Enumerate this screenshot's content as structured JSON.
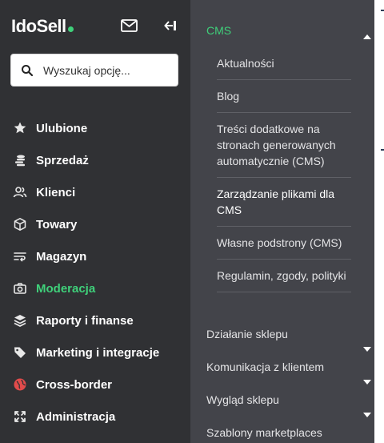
{
  "brand": {
    "name_part1": "I",
    "name_part2": "do",
    "name_part3": "Sell",
    "accent": "#3fd07a"
  },
  "header": {
    "icons": [
      "mail-icon",
      "collapse-sidebar-icon"
    ]
  },
  "search": {
    "placeholder": "Wyszukaj opcję..."
  },
  "nav": {
    "items": [
      {
        "label": "Ulubione",
        "icon": "star-icon"
      },
      {
        "label": "Sprzedaż",
        "icon": "coins-icon"
      },
      {
        "label": "Klienci",
        "icon": "users-icon"
      },
      {
        "label": "Towary",
        "icon": "box-icon"
      },
      {
        "label": "Magazyn",
        "icon": "warehouse-icon"
      },
      {
        "label": "Moderacja",
        "icon": "camera-icon",
        "active": true
      },
      {
        "label": "Raporty i finanse",
        "icon": "layers-icon"
      },
      {
        "label": "Marketing i integracje",
        "icon": "tag-icon"
      },
      {
        "label": "Cross-border",
        "icon": "globe-icon"
      },
      {
        "label": "Administracja",
        "icon": "expand-icon"
      }
    ]
  },
  "panel": {
    "header": "CMS",
    "sub_items": [
      "Aktualności",
      "Blog",
      "Treści dodatkowe na stronach generowanych automatycznie (CMS)",
      "Zarządzanie plikami dla CMS",
      "Własne podstrony (CMS)",
      "Regulamin, zgody, polityki"
    ],
    "sections": [
      "Działanie sklepu",
      "Komunikacja z klientem",
      "Wygląd sklepu",
      "Szablony marketplaces"
    ]
  }
}
